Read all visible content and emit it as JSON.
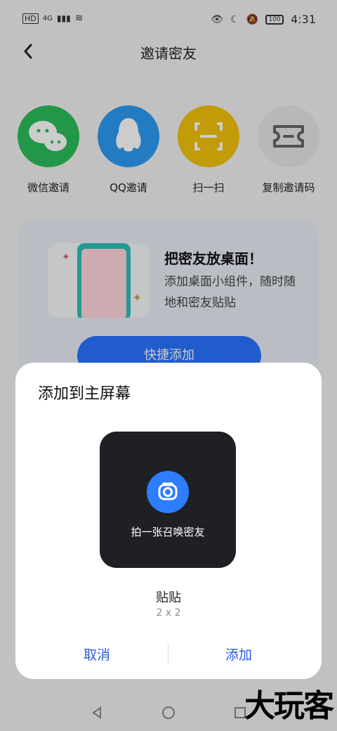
{
  "status": {
    "time": "4:31",
    "battery": "100",
    "left_icons": [
      "hd-icon",
      "4g-icon",
      "signal-icon",
      "wifi-icon"
    ],
    "right_icons": [
      "eye-icon",
      "moon-icon",
      "mute-icon",
      "battery-icon"
    ]
  },
  "nav": {
    "title": "邀请密友"
  },
  "share": {
    "items": [
      {
        "label": "微信邀请",
        "icon": "wechat-icon",
        "color": "#2bbd5a"
      },
      {
        "label": "QQ邀请",
        "icon": "qq-penguin-icon",
        "color": "#2c9bf2"
      },
      {
        "label": "扫一扫",
        "icon": "scan-icon",
        "color": "#f3c20c"
      },
      {
        "label": "复制邀请码",
        "icon": "ticket-icon",
        "color": "#e6e6e6"
      }
    ]
  },
  "promo": {
    "title": "把密友放桌面！",
    "desc": "添加桌面小组件，随时随地和密友贴贴",
    "button": "快捷添加"
  },
  "dialog": {
    "title": "添加到主屏幕",
    "widget": {
      "text": "拍一张召唤密友",
      "name": "贴贴",
      "size": "2 x 2"
    },
    "cancel": "取消",
    "add": "添加",
    "accent": "#2a5bd7"
  },
  "watermark": "大玩客"
}
